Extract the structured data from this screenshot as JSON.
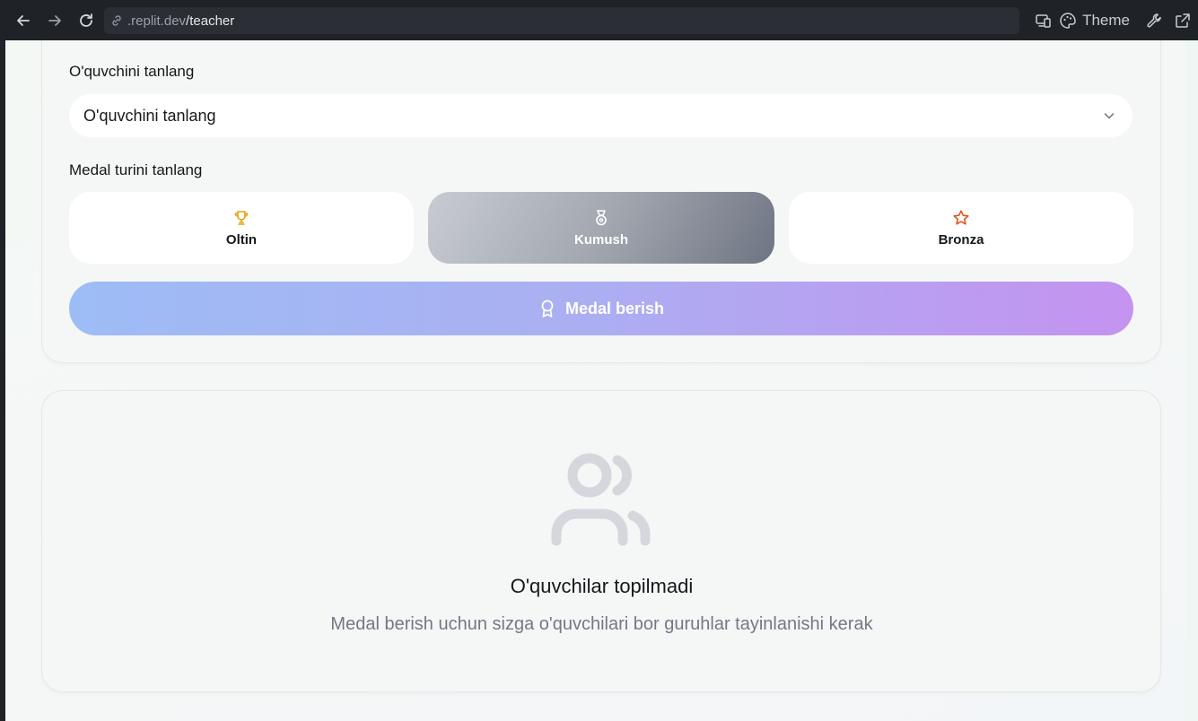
{
  "browser": {
    "url_domain": ".replit.dev",
    "url_path": "/teacher",
    "theme_label": "Theme"
  },
  "form": {
    "student_label": "O'quvchini tanlang",
    "student_select_value": "O'quvchini tanlang",
    "medal_type_label": "Medal turini tanlang",
    "medals": [
      {
        "label": "Oltin",
        "icon": "trophy-icon",
        "color": "#e2a612",
        "selected": false
      },
      {
        "label": "Kumush",
        "icon": "medal-icon",
        "color": "#ffffff",
        "selected": true
      },
      {
        "label": "Bronza",
        "icon": "star-icon",
        "color": "#e0551a",
        "selected": false
      }
    ],
    "submit_label": "Medal berish"
  },
  "empty_state": {
    "icon": "users-icon",
    "title": "O'quvchilar topilmadi",
    "subtitle": "Medal berish uchun sizga o'quvchilari bor guruhlar tayinlanishi kerak"
  }
}
